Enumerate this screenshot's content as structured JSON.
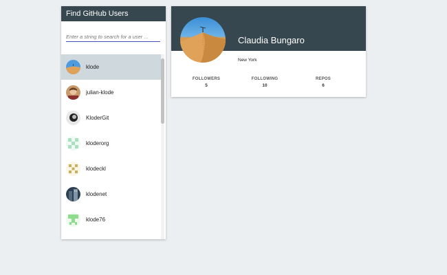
{
  "search": {
    "title": "Find GitHub Users",
    "placeholder": "Enter a string to search for a user ..."
  },
  "users": [
    {
      "login": "klode",
      "selected": true,
      "avatar": "desert-photo"
    },
    {
      "login": "julian-klode",
      "selected": false,
      "avatar": "person-photo"
    },
    {
      "login": "KloderGit",
      "selected": false,
      "avatar": "bw-photo"
    },
    {
      "login": "kloderorg",
      "selected": false,
      "avatar": "identicon-green"
    },
    {
      "login": "klodeckl",
      "selected": false,
      "avatar": "identicon-olive"
    },
    {
      "login": "klodenet",
      "selected": false,
      "avatar": "building-photo"
    },
    {
      "login": "klode76",
      "selected": false,
      "avatar": "identicon-green2"
    }
  ],
  "profile": {
    "name": "Claudia Bungaro",
    "location": "New York",
    "stats": [
      {
        "label": "FOLLOWERS",
        "value": "5"
      },
      {
        "label": "FOLLOWING",
        "value": "10"
      },
      {
        "label": "REPOS",
        "value": "6"
      }
    ]
  },
  "colors": {
    "header": "#37474f",
    "background": "#eceff1",
    "selected": "#cfd8dc",
    "input_underline": "#3f51b5"
  }
}
